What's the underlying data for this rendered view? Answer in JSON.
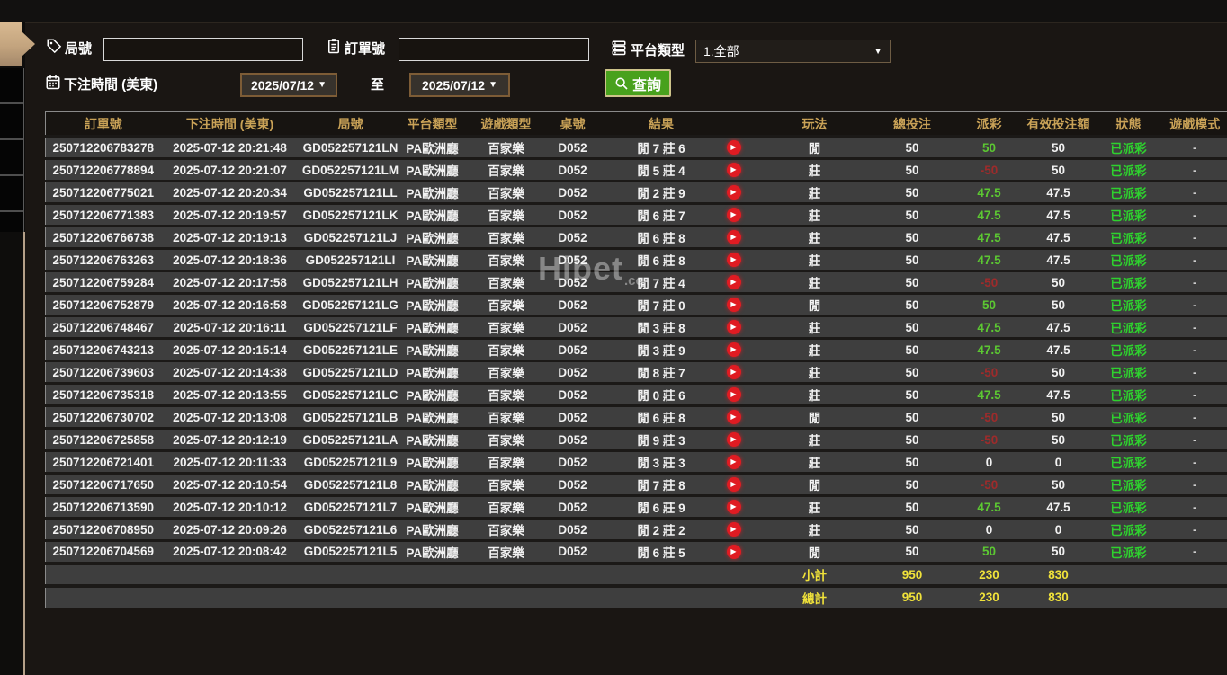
{
  "filters": {
    "round_label": "局號",
    "round_value": "",
    "order_label": "訂單號",
    "order_value": "",
    "platform_label": "平台類型",
    "platform_value": "1.全部",
    "time_label": "下注時間 (美東)",
    "date_from": "2025/07/12",
    "to_label": "至",
    "date_to": "2025/07/12",
    "search_label": "查詢",
    "caret": "▼"
  },
  "icons": {
    "round": "tag-icon",
    "order": "clipboard-icon",
    "platform": "server-stack-icon",
    "time": "calendar-icon",
    "search": "magnifier-icon",
    "play": "play-icon"
  },
  "watermark": {
    "text": "Hibet",
    "suffix": ".cc"
  },
  "table": {
    "headers": [
      "訂單號",
      "下注時間 (美東)",
      "局號",
      "平台類型",
      "遊戲類型",
      "桌號",
      "結果",
      "玩法",
      "總投注",
      "派彩",
      "有效投注額",
      "狀態",
      "遊戲模式"
    ],
    "rows": [
      {
        "order": "250712206783278",
        "time": "2025-07-12 20:21:48",
        "round": "GD052257121LN",
        "platform": "PA歐洲廳",
        "game": "百家樂",
        "table_no": "D052",
        "result": "閒 7 莊 6",
        "bet_type": "閒",
        "total_bet": "50",
        "payout": "50",
        "payout_sign": "pos",
        "valid_bet": "50",
        "status": "已派彩",
        "mode": "-"
      },
      {
        "order": "250712206778894",
        "time": "2025-07-12 20:21:07",
        "round": "GD052257121LM",
        "platform": "PA歐洲廳",
        "game": "百家樂",
        "table_no": "D052",
        "result": "閒 5 莊 4",
        "bet_type": "莊",
        "total_bet": "50",
        "payout": "-50",
        "payout_sign": "neg",
        "valid_bet": "50",
        "status": "已派彩",
        "mode": "-"
      },
      {
        "order": "250712206775021",
        "time": "2025-07-12 20:20:34",
        "round": "GD052257121LL",
        "platform": "PA歐洲廳",
        "game": "百家樂",
        "table_no": "D052",
        "result": "閒 2 莊 9",
        "bet_type": "莊",
        "total_bet": "50",
        "payout": "47.5",
        "payout_sign": "pos",
        "valid_bet": "47.5",
        "status": "已派彩",
        "mode": "-"
      },
      {
        "order": "250712206771383",
        "time": "2025-07-12 20:19:57",
        "round": "GD052257121LK",
        "platform": "PA歐洲廳",
        "game": "百家樂",
        "table_no": "D052",
        "result": "閒 6 莊 7",
        "bet_type": "莊",
        "total_bet": "50",
        "payout": "47.5",
        "payout_sign": "pos",
        "valid_bet": "47.5",
        "status": "已派彩",
        "mode": "-"
      },
      {
        "order": "250712206766738",
        "time": "2025-07-12 20:19:13",
        "round": "GD052257121LJ",
        "platform": "PA歐洲廳",
        "game": "百家樂",
        "table_no": "D052",
        "result": "閒 6 莊 8",
        "bet_type": "莊",
        "total_bet": "50",
        "payout": "47.5",
        "payout_sign": "pos",
        "valid_bet": "47.5",
        "status": "已派彩",
        "mode": "-"
      },
      {
        "order": "250712206763263",
        "time": "2025-07-12 20:18:36",
        "round": "GD052257121LI",
        "platform": "PA歐洲廳",
        "game": "百家樂",
        "table_no": "D052",
        "result": "閒 6 莊 8",
        "bet_type": "莊",
        "total_bet": "50",
        "payout": "47.5",
        "payout_sign": "pos",
        "valid_bet": "47.5",
        "status": "已派彩",
        "mode": "-"
      },
      {
        "order": "250712206759284",
        "time": "2025-07-12 20:17:58",
        "round": "GD052257121LH",
        "platform": "PA歐洲廳",
        "game": "百家樂",
        "table_no": "D052",
        "result": "閒 7 莊 4",
        "bet_type": "莊",
        "total_bet": "50",
        "payout": "-50",
        "payout_sign": "neg",
        "valid_bet": "50",
        "status": "已派彩",
        "mode": "-"
      },
      {
        "order": "250712206752879",
        "time": "2025-07-12 20:16:58",
        "round": "GD052257121LG",
        "platform": "PA歐洲廳",
        "game": "百家樂",
        "table_no": "D052",
        "result": "閒 7 莊 0",
        "bet_type": "閒",
        "total_bet": "50",
        "payout": "50",
        "payout_sign": "pos",
        "valid_bet": "50",
        "status": "已派彩",
        "mode": "-"
      },
      {
        "order": "250712206748467",
        "time": "2025-07-12 20:16:11",
        "round": "GD052257121LF",
        "platform": "PA歐洲廳",
        "game": "百家樂",
        "table_no": "D052",
        "result": "閒 3 莊 8",
        "bet_type": "莊",
        "total_bet": "50",
        "payout": "47.5",
        "payout_sign": "pos",
        "valid_bet": "47.5",
        "status": "已派彩",
        "mode": "-"
      },
      {
        "order": "250712206743213",
        "time": "2025-07-12 20:15:14",
        "round": "GD052257121LE",
        "platform": "PA歐洲廳",
        "game": "百家樂",
        "table_no": "D052",
        "result": "閒 3 莊 9",
        "bet_type": "莊",
        "total_bet": "50",
        "payout": "47.5",
        "payout_sign": "pos",
        "valid_bet": "47.5",
        "status": "已派彩",
        "mode": "-"
      },
      {
        "order": "250712206739603",
        "time": "2025-07-12 20:14:38",
        "round": "GD052257121LD",
        "platform": "PA歐洲廳",
        "game": "百家樂",
        "table_no": "D052",
        "result": "閒 8 莊 7",
        "bet_type": "莊",
        "total_bet": "50",
        "payout": "-50",
        "payout_sign": "neg",
        "valid_bet": "50",
        "status": "已派彩",
        "mode": "-"
      },
      {
        "order": "250712206735318",
        "time": "2025-07-12 20:13:55",
        "round": "GD052257121LC",
        "platform": "PA歐洲廳",
        "game": "百家樂",
        "table_no": "D052",
        "result": "閒 0 莊 6",
        "bet_type": "莊",
        "total_bet": "50",
        "payout": "47.5",
        "payout_sign": "pos",
        "valid_bet": "47.5",
        "status": "已派彩",
        "mode": "-"
      },
      {
        "order": "250712206730702",
        "time": "2025-07-12 20:13:08",
        "round": "GD052257121LB",
        "platform": "PA歐洲廳",
        "game": "百家樂",
        "table_no": "D052",
        "result": "閒 6 莊 8",
        "bet_type": "閒",
        "total_bet": "50",
        "payout": "-50",
        "payout_sign": "neg",
        "valid_bet": "50",
        "status": "已派彩",
        "mode": "-"
      },
      {
        "order": "250712206725858",
        "time": "2025-07-12 20:12:19",
        "round": "GD052257121LA",
        "platform": "PA歐洲廳",
        "game": "百家樂",
        "table_no": "D052",
        "result": "閒 9 莊 3",
        "bet_type": "莊",
        "total_bet": "50",
        "payout": "-50",
        "payout_sign": "neg",
        "valid_bet": "50",
        "status": "已派彩",
        "mode": "-"
      },
      {
        "order": "250712206721401",
        "time": "2025-07-12 20:11:33",
        "round": "GD052257121L9",
        "platform": "PA歐洲廳",
        "game": "百家樂",
        "table_no": "D052",
        "result": "閒 3 莊 3",
        "bet_type": "莊",
        "total_bet": "50",
        "payout": "0",
        "payout_sign": "zero",
        "valid_bet": "0",
        "status": "已派彩",
        "mode": "-"
      },
      {
        "order": "250712206717650",
        "time": "2025-07-12 20:10:54",
        "round": "GD052257121L8",
        "platform": "PA歐洲廳",
        "game": "百家樂",
        "table_no": "D052",
        "result": "閒 7 莊 8",
        "bet_type": "閒",
        "total_bet": "50",
        "payout": "-50",
        "payout_sign": "neg",
        "valid_bet": "50",
        "status": "已派彩",
        "mode": "-"
      },
      {
        "order": "250712206713590",
        "time": "2025-07-12 20:10:12",
        "round": "GD052257121L7",
        "platform": "PA歐洲廳",
        "game": "百家樂",
        "table_no": "D052",
        "result": "閒 6 莊 9",
        "bet_type": "莊",
        "total_bet": "50",
        "payout": "47.5",
        "payout_sign": "pos",
        "valid_bet": "47.5",
        "status": "已派彩",
        "mode": "-"
      },
      {
        "order": "250712206708950",
        "time": "2025-07-12 20:09:26",
        "round": "GD052257121L6",
        "platform": "PA歐洲廳",
        "game": "百家樂",
        "table_no": "D052",
        "result": "閒 2 莊 2",
        "bet_type": "莊",
        "total_bet": "50",
        "payout": "0",
        "payout_sign": "zero",
        "valid_bet": "0",
        "status": "已派彩",
        "mode": "-"
      },
      {
        "order": "250712206704569",
        "time": "2025-07-12 20:08:42",
        "round": "GD052257121L5",
        "platform": "PA歐洲廳",
        "game": "百家樂",
        "table_no": "D052",
        "result": "閒 6 莊 5",
        "bet_type": "閒",
        "total_bet": "50",
        "payout": "50",
        "payout_sign": "pos",
        "valid_bet": "50",
        "status": "已派彩",
        "mode": "-"
      }
    ],
    "subtotal": {
      "label": "小計",
      "total_bet": "950",
      "payout": "230",
      "valid_bet": "830"
    },
    "total": {
      "label": "總計",
      "total_bet": "950",
      "payout": "230",
      "valid_bet": "830"
    }
  },
  "colors": {
    "accent_gold": "#c9a257",
    "status_green": "#2ed12e",
    "payout_green": "#5cc832",
    "payout_red": "#9e2b2b",
    "summary_yellow": "#f0e23a",
    "button_green": "#48a11d",
    "drawer_tan": "#c7a883",
    "play_red": "#e01b22"
  }
}
